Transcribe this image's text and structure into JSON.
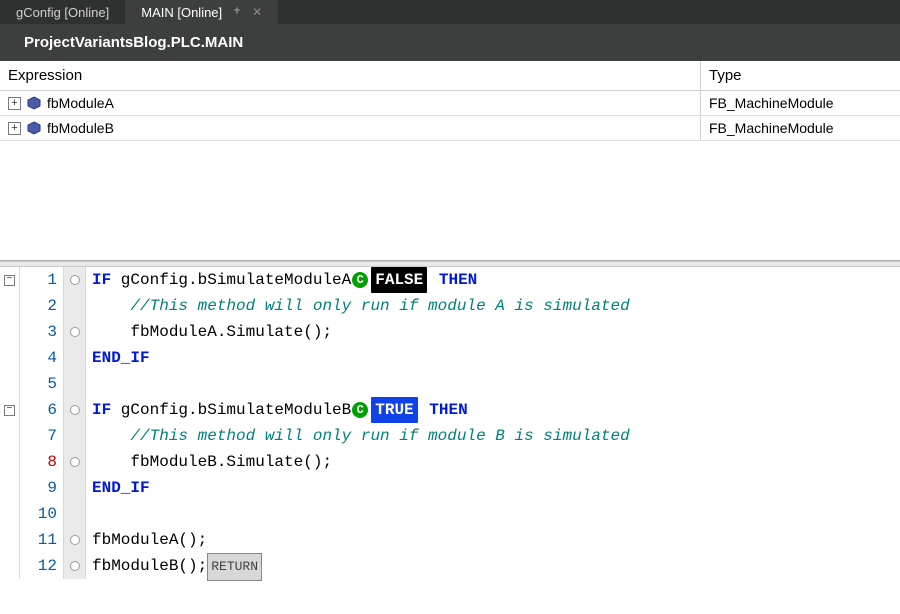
{
  "tabs": {
    "inactive": {
      "label": "gConfig [Online]"
    },
    "active": {
      "label": "MAIN [Online]"
    }
  },
  "title": "ProjectVariantsBlog.PLC.MAIN",
  "decl": {
    "header": {
      "expr": "Expression",
      "type": "Type"
    },
    "rows": [
      {
        "name": "fbModuleA",
        "type": "FB_MachineModule"
      },
      {
        "name": "fbModuleB",
        "type": "FB_MachineModule"
      }
    ]
  },
  "code": {
    "online_values": {
      "simA": "FALSE",
      "simB": "TRUE"
    },
    "return_label": "RETURN",
    "lines": [
      {
        "n": "1",
        "bp": true
      },
      {
        "n": "2",
        "bp": false
      },
      {
        "n": "3",
        "bp": true
      },
      {
        "n": "4",
        "bp": false
      },
      {
        "n": "5",
        "bp": false
      },
      {
        "n": "6",
        "bp": true
      },
      {
        "n": "7",
        "bp": false
      },
      {
        "n": "8",
        "bp": true
      },
      {
        "n": "9",
        "bp": false
      },
      {
        "n": "10",
        "bp": false
      },
      {
        "n": "11",
        "bp": true
      },
      {
        "n": "12",
        "bp": true
      }
    ],
    "tok": {
      "IF": "IF",
      "THEN": "THEN",
      "END_IF": "END_IF",
      "l1_expr": " gConfig.bSimulateModuleA",
      "l2_cm": "//This method will only run if module A is simulated",
      "l3_txt": "fbModuleA.Simulate();",
      "l6_expr": " gConfig.bSimulateModuleB",
      "l7_cm": "//This method will only run if module B is simulated",
      "l8_txt": "fbModuleB.Simulate();",
      "l11_txt": "fbModuleA();",
      "l12_txt": "fbModuleB();"
    }
  }
}
